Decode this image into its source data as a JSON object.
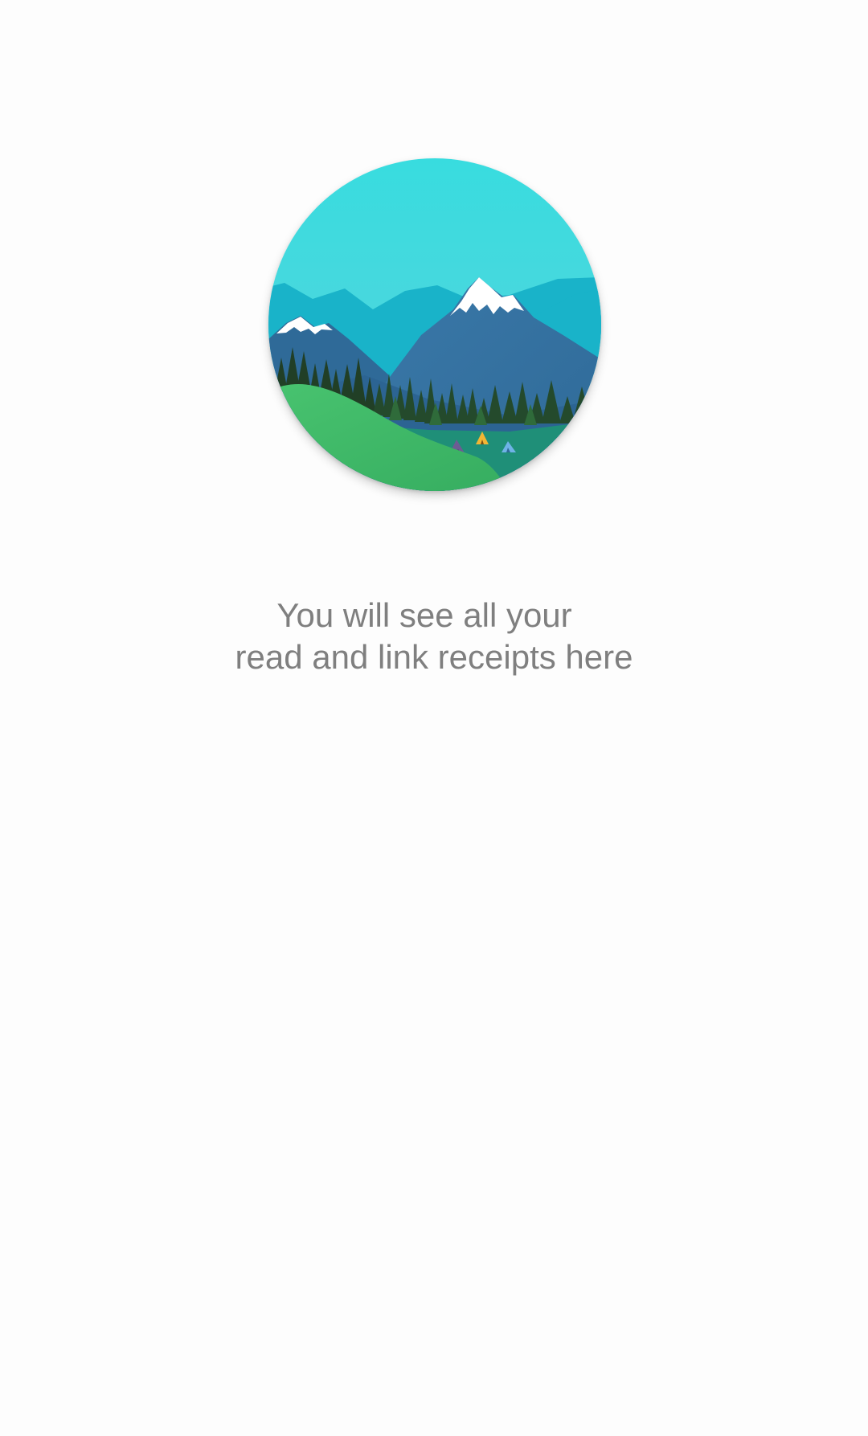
{
  "empty_state": {
    "illustration": "mountain-landscape-illustration",
    "message_line1": "You will see all your",
    "message_line2": "read and link receipts here"
  },
  "colors": {
    "background": "#fdfdfd",
    "message_text": "#7f7f7f",
    "sky": "#3cd9dd",
    "grass": "#3db56a"
  }
}
